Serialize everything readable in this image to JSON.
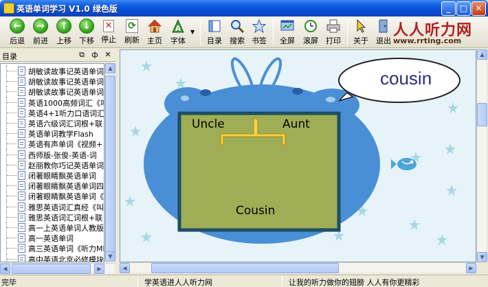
{
  "window": {
    "title": "英语单词学习 V1.0 绿色版",
    "buttons": {
      "minimize": "_",
      "maximize": "□",
      "close": "✕"
    }
  },
  "toolbar": {
    "back": "后退",
    "forward": "前进",
    "up": "上移",
    "down": "下移",
    "stop": "停止",
    "refresh": "刷新",
    "home": "主页",
    "font": "字体",
    "toc": "目录",
    "search": "搜索",
    "bookmark": "书签",
    "fullscreen": "全屏",
    "scroll": "滚屏",
    "print": "打印",
    "about": "关于",
    "exit": "退出"
  },
  "logo": {
    "brand": "人人听力网",
    "url": "www.rrting.com"
  },
  "sidebar": {
    "title": "目录",
    "pin": "ф",
    "close": "✕",
    "items": [
      "胡敏读故事记英语单词",
      "胡敏读故事记英语单词",
      "胡敏读故事记英语单词",
      "英语1000高频词汇《叫",
      "英语4+1听力口语词汇",
      "英语六级词汇词根+联",
      "英语单词教学Flash",
      "英语有声单词《视频+",
      "西师版-张俊-英语-词",
      "赵丽教你巧记英语单词",
      "闭著眼睛飘英语单词",
      "闭著眼睛飘英语单词四",
      "闭著眼睛飘英语单词《",
      "雅思英语词汇真经《叫",
      "雅思英语词汇词根+联",
      "高一上英语单词人教版",
      "高一英语单词",
      "高三英语单词《听力MP",
      "高中英语北京必修模块"
    ]
  },
  "content": {
    "word": "cousin",
    "labels": {
      "uncle": "Uncle",
      "aunt": "Aunt",
      "cousin": "Cousin"
    }
  },
  "statusbar": {
    "left": "完毕",
    "middle": "学英语进人人听力网",
    "right": "让我的听力做你的翅膀 人人有你更精彩"
  },
  "colors": {
    "titlebar": "#0a58e0",
    "body_blue": "#4a8fd6",
    "board_green": "#9fad55",
    "board_border": "#1d4f63",
    "connector": "#f2d24a",
    "background": "#e6f3f8"
  }
}
